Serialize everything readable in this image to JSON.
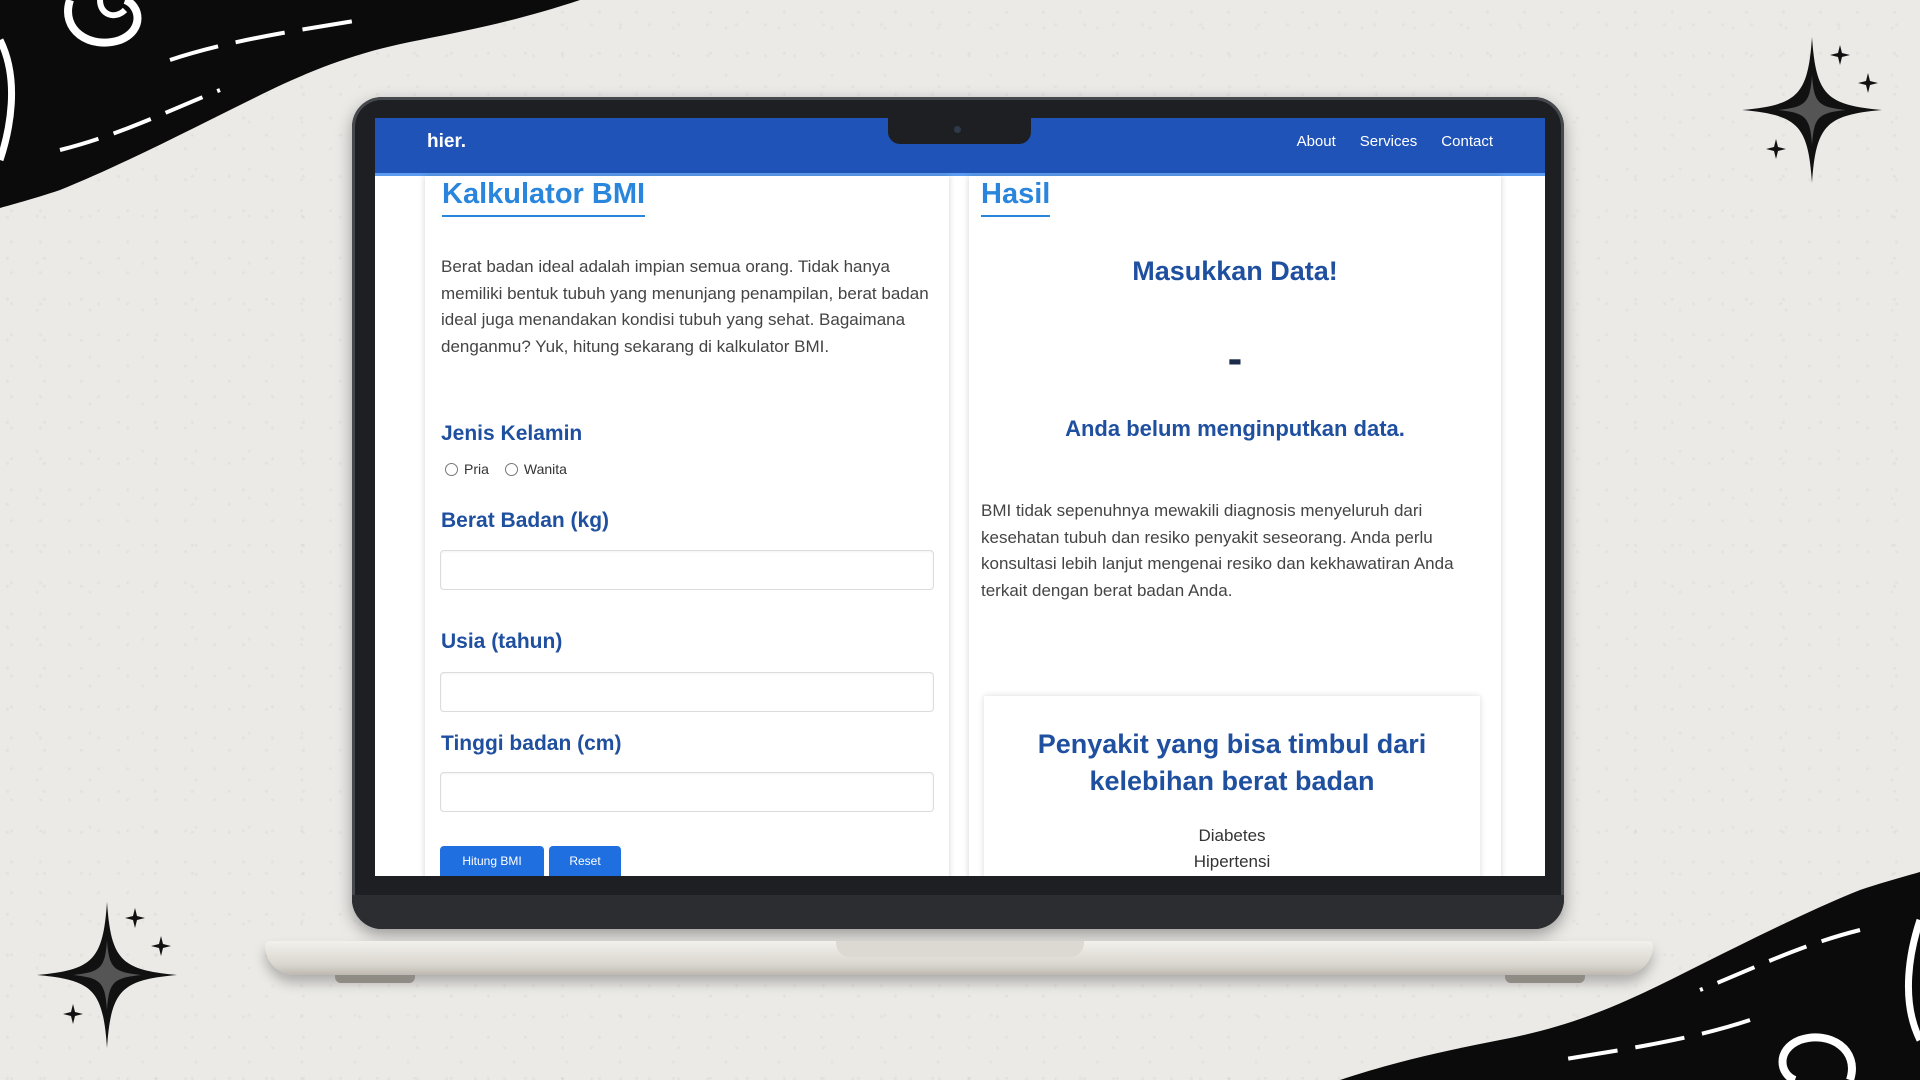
{
  "navbar": {
    "brand": "hier.",
    "links": [
      "About",
      "Services",
      "Contact"
    ]
  },
  "calculator": {
    "title": "Kalkulator BMI",
    "description": "Berat badan ideal adalah impian semua orang. Tidak hanya memiliki bentuk tubuh yang menunjang penampilan, berat badan ideal juga menandakan kondisi tubuh yang sehat. Bagaimana denganmu? Yuk, hitung sekarang di kalkulator BMI.",
    "gender_label": "Jenis Kelamin",
    "gender_options": [
      "Pria",
      "Wanita"
    ],
    "weight_label": "Berat Badan (kg)",
    "weight_value": "",
    "age_label": "Usia (tahun)",
    "age_value": "",
    "height_label": "Tinggi badan (cm)",
    "height_value": "",
    "calculate_button": "Hitung BMI",
    "reset_button": "Reset"
  },
  "result": {
    "title": "Hasil",
    "heading": "Masukkan Data!",
    "value": "-",
    "message": "Anda belum menginputkan data.",
    "disclaimer": "BMI tidak sepenuhnya mewakili diagnosis menyeluruh dari kesehatan tubuh dan resiko penyakit seseorang. Anda perlu konsultasi lebih lanjut mengenai resiko dan kekhawatiran Anda terkait dengan berat badan Anda.",
    "diseases_title": "Penyakit yang bisa timbul dari kelebihan berat badan",
    "diseases": [
      "Diabetes",
      "Hipertensi"
    ]
  },
  "colors": {
    "navbar": "#1f53b8",
    "title": "#2a86dd",
    "label": "#1f4f9f",
    "button": "#1f6fe0"
  }
}
